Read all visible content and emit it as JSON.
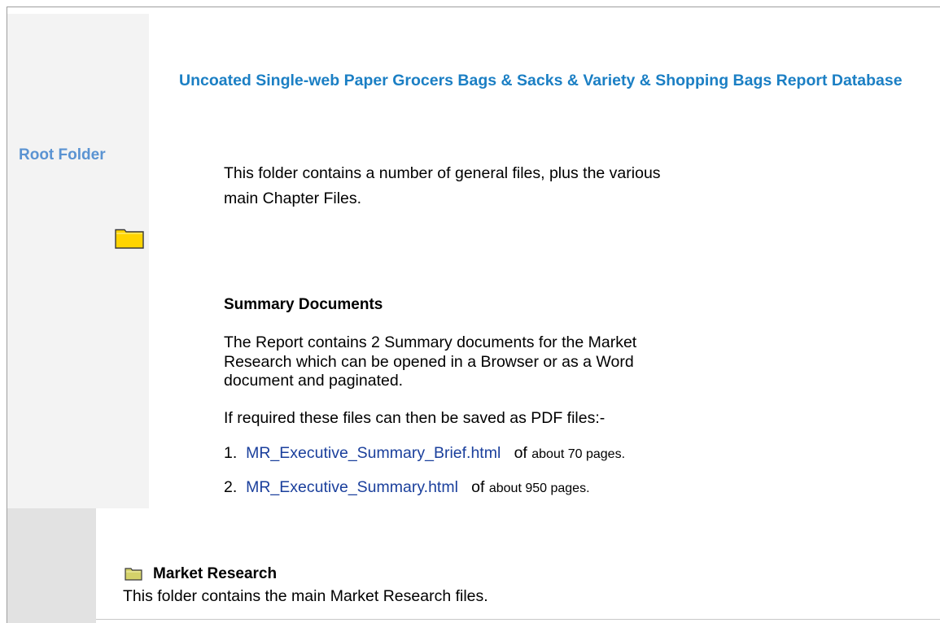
{
  "page": {
    "title": "Uncoated Single-web Paper Grocers Bags & Sacks & Variety & Shopping Bags Report Database",
    "root_folder_label": "Root Folder"
  },
  "root_section": {
    "intro_line1": "This folder contains a number of general files, plus the various",
    "intro_line2": "main Chapter Files.",
    "folder_icon": "folder-icon"
  },
  "summary": {
    "heading": "Summary Documents",
    "description_line1": "The Report contains 2 Summary documents for the Market",
    "description_line2": "Research which can be opened in a Browser or as a Word",
    "description_line3": "document and paginated.",
    "pdf_note": "If required these files can then be saved as PDF files:-",
    "files": [
      {
        "number": "1.",
        "link": "MR_Executive_Summary_Brief.html",
        "of": "of",
        "pages": "about 70 pages."
      },
      {
        "number": "2.",
        "link": "MR_Executive_Summary.html",
        "of": "of",
        "pages": "about 950 pages."
      }
    ]
  },
  "market_research": {
    "title": "Market Research",
    "description": "This folder contains the main Market Research files.",
    "folder_icon": "folder-icon"
  },
  "colors": {
    "title_blue": "#1b7fc4",
    "root_label_blue": "#5a93d2",
    "link_blue": "#1a3f9c",
    "folder_yellow": "#ffd400",
    "folder_olive": "#d4d26a"
  }
}
